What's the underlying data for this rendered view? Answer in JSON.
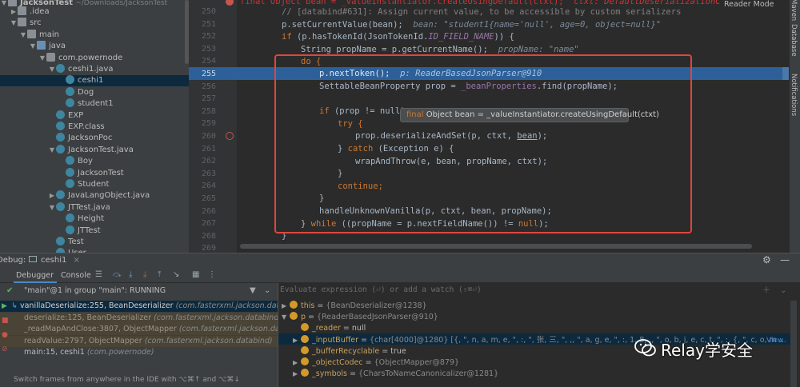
{
  "project_tree": {
    "root": "JacksonTest",
    "root_path": "~/Downloads/JacksonTest",
    "items": [
      {
        "label": ".idea",
        "indent": 1,
        "icon": "folder-icon",
        "expand": "right"
      },
      {
        "label": "src",
        "indent": 1,
        "icon": "folder-icon",
        "expand": "down"
      },
      {
        "label": "main",
        "indent": 2,
        "icon": "folder-icon",
        "expand": "down"
      },
      {
        "label": "java",
        "indent": 3,
        "icon": "source-folder-icon",
        "expand": "down"
      },
      {
        "label": "com.powernode",
        "indent": 4,
        "icon": "package-icon",
        "expand": "down"
      },
      {
        "label": "ceshi1.java",
        "indent": 5,
        "icon": "java-file-icon",
        "expand": "down"
      },
      {
        "label": "ceshi1",
        "indent": 6,
        "icon": "class-icon",
        "expand": "",
        "selected": true
      },
      {
        "label": "Dog",
        "indent": 6,
        "icon": "class-icon",
        "expand": ""
      },
      {
        "label": "student1",
        "indent": 6,
        "icon": "class-icon",
        "expand": ""
      },
      {
        "label": "EXP",
        "indent": 5,
        "icon": "class-icon",
        "expand": ""
      },
      {
        "label": "EXP.class",
        "indent": 5,
        "icon": "class-file-icon",
        "expand": ""
      },
      {
        "label": "JacksonPoc",
        "indent": 5,
        "icon": "class-icon",
        "expand": ""
      },
      {
        "label": "JacksonTest.java",
        "indent": 5,
        "icon": "java-file-icon",
        "expand": "down"
      },
      {
        "label": "Boy",
        "indent": 6,
        "icon": "class-icon",
        "expand": ""
      },
      {
        "label": "JacksonTest",
        "indent": 6,
        "icon": "class-icon",
        "expand": ""
      },
      {
        "label": "Student",
        "indent": 6,
        "icon": "class-icon",
        "expand": ""
      },
      {
        "label": "JavaLangObject.java",
        "indent": 5,
        "icon": "java-file-icon",
        "expand": "right"
      },
      {
        "label": "JTTest.java",
        "indent": 5,
        "icon": "java-file-icon",
        "expand": "down"
      },
      {
        "label": "Height",
        "indent": 6,
        "icon": "class-icon",
        "expand": ""
      },
      {
        "label": "JTTest",
        "indent": 6,
        "icon": "class-icon",
        "expand": ""
      },
      {
        "label": "Test",
        "indent": 5,
        "icon": "class-icon",
        "expand": ""
      },
      {
        "label": "User",
        "indent": 5,
        "icon": "class-icon",
        "expand": ""
      }
    ]
  },
  "editor": {
    "reader_mode": "Reader Mode",
    "tooltip": {
      "kw": "final",
      "text": " Object bean = _valueInstantiator.createUsingDefault(ctxt)"
    },
    "line_numbers": [
      "250",
      "251",
      "252",
      "253",
      "254",
      "255",
      "256",
      "257",
      "258",
      "259",
      "260",
      "261",
      "262",
      "263",
      "264",
      "265",
      "266",
      "267",
      "268",
      "269"
    ],
    "lines": {
      "l249a": "final Object bean = _valueInstantiator.createUsingDefault(ctxt);",
      "l249b": "ctxt: DefaultDeserializationC",
      "l250": "// [databind#631]: Assign current value, to be accessible by custom serializers",
      "l251a": "p.setCurrentValue(bean);",
      "l251b": "bean: \"student1{name='null', age=0, object=null}\"",
      "l252a": "if",
      "l252b": " (p.hasTokenId(JsonTokenId.",
      "l252c": "ID_FIELD_NAME",
      "l252d": ")) {",
      "l253a": "String propName = p.getCurrentName();",
      "l253b": "propName: \"name\"",
      "l254": "do {",
      "l255a": "p.nextToken();",
      "l255b": "p: ReaderBasedJsonParser@910",
      "l256a": "SettableBeanProperty prop = ",
      "l256b": "_beanProperties",
      "l256c": ".find(propName);",
      "l258a": "if",
      "l258b": " (prop != null)",
      "l259": "try {",
      "l260a": "prop.deserializeAndSet(p, ctxt, ",
      "l260b": "bean",
      "l260c": ");",
      "l261a": "} ",
      "l261b": "catch",
      "l261c": " (Exception e) {",
      "l262": "wrapAndThrow(e, bean, propName, ctxt);",
      "l263": "}",
      "l264": "continue;",
      "l265": "}",
      "l266": "handleUnknownVanilla(p, ctxt, bean, propName);",
      "l267a": "} ",
      "l267b": "while",
      "l267c": " ((propName = p.nextFieldName()) != ",
      "l267d": "null",
      "l267e": ");",
      "l268": "}"
    }
  },
  "right_strip": {
    "maven": "Maven",
    "database": "Database",
    "notifications": "Notifications"
  },
  "debug": {
    "label": "Debug:",
    "session_tab": "ceshi1",
    "tabs": [
      "Debugger",
      "Console"
    ],
    "thread": "\"main\"@1 in group \"main\": RUNNING",
    "eval_placeholder": "Evaluate expression (⏎) or add a watch (⇧⌘⏎)",
    "frames": [
      {
        "method": "vanillaDeserialize:255, BeanDeserializer",
        "pkg": "(com.fasterxml.jackson.databind.",
        "kind": "cur"
      },
      {
        "method": "deserialize:125, BeanDeserializer",
        "pkg": "(com.fasterxml.jackson.databind.deser)",
        "kind": "lib"
      },
      {
        "method": "_readMapAndClose:3807, ObjectMapper",
        "pkg": "(com.fasterxml.jackson.databind",
        "kind": "lib"
      },
      {
        "method": "readValue:2797, ObjectMapper",
        "pkg": "(com.fasterxml.jackson.databind)",
        "kind": "lib"
      },
      {
        "method": "main:15, ceshi1",
        "pkg": "(com.powernode)",
        "kind": "normal"
      }
    ],
    "status_hint": "Switch frames from anywhere in the IDE with ⌥⌘↑ and ⌥⌘↓",
    "variables": [
      {
        "name": "this",
        "value": "{BeanDeserializer@1238}",
        "tri": "right",
        "indent": 0
      },
      {
        "name": "p",
        "value": "{ReaderBasedJsonParser@910}",
        "tri": "down",
        "indent": 0
      },
      {
        "name": "_reader",
        "value": "null",
        "tri": "",
        "indent": 1
      },
      {
        "name": "_inputBuffer",
        "value": "{char[4000]@1280} [{, \", n, a, m, e, \", :, \", 张, 三, \", ,, \", a, g, e, \", :, 1, 8, ,, \", o, b, j, e, c, t, \", :, {, \", c, o, m ...",
        "tri": "right",
        "indent": 1,
        "selected": true
      },
      {
        "name": "_bufferRecyclable",
        "value": "true",
        "tri": "",
        "indent": 1
      },
      {
        "name": "_objectCodec",
        "value": "{ObjectMapper@879}",
        "tri": "right",
        "indent": 1
      },
      {
        "name": "_symbols",
        "value": "{CharsToNameCanonicalizer@1281}",
        "tri": "right",
        "indent": 1
      }
    ],
    "view_link": "View"
  },
  "watermark": "Relay学安全"
}
